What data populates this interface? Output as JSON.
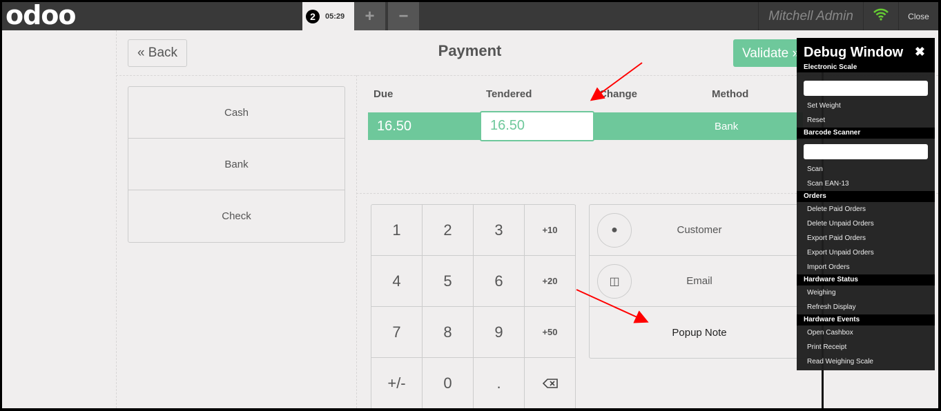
{
  "header": {
    "logo": "odoo",
    "order_number": "2",
    "order_time": "05:29",
    "add_label": "+",
    "remove_label": "−",
    "user": "Mitchell Admin",
    "close_label": "Close"
  },
  "payment": {
    "back_label": "« Back",
    "title": "Payment",
    "validate_label": "Validate »",
    "methods": [
      "Cash",
      "Bank",
      "Check"
    ],
    "columns": {
      "due": "Due",
      "tendered": "Tendered",
      "change": "Change",
      "method": "Method"
    },
    "line": {
      "due": "16.50",
      "tendered": "16.50",
      "method": "Bank"
    },
    "numpad": [
      "1",
      "2",
      "3",
      "+10",
      "4",
      "5",
      "6",
      "+20",
      "7",
      "8",
      "9",
      "+50",
      "+/-",
      "0",
      "."
    ],
    "actions": {
      "customer": "Customer",
      "email": "Email",
      "popup_note": "Popup Note"
    }
  },
  "debug": {
    "title": "Debug Window",
    "sections": [
      {
        "title": "Electronic Scale",
        "has_input": true,
        "items": [
          "Set Weight",
          "Reset"
        ]
      },
      {
        "title": "Barcode Scanner",
        "has_input": true,
        "items": [
          "Scan",
          "Scan EAN-13"
        ]
      },
      {
        "title": "Orders",
        "items": [
          "Delete Paid Orders",
          "Delete Unpaid Orders",
          "Export Paid Orders",
          "Export Unpaid Orders",
          "Import Orders"
        ]
      },
      {
        "title": "Hardware Status",
        "items": [
          "Weighing",
          "Refresh Display"
        ]
      },
      {
        "title": "Hardware Events",
        "items": [
          "Open Cashbox",
          "Print Receipt",
          "Read Weighing Scale"
        ]
      }
    ]
  },
  "colors": {
    "accent": "#6ec89b",
    "topbar": "#393939",
    "annotation_arrow": "#ff0000"
  }
}
